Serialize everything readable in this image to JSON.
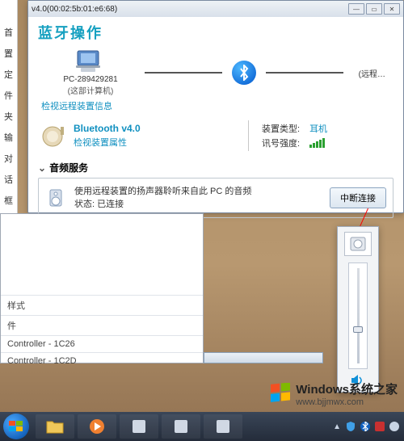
{
  "left_sidebar": {
    "items": [
      "首",
      "置",
      "定",
      "件夹",
      "输对话框"
    ]
  },
  "window": {
    "title": "v4.0(00:02:5b:01:e6:68)",
    "heading": "蓝牙操作",
    "pc": {
      "name": "PC-289429281",
      "sub": "(这部计算机)"
    },
    "remote": {
      "label": "(远程…"
    },
    "check_remote_info": "检视远程装置信息",
    "device": {
      "name": "Bluetooth v4.0",
      "check_props": "检视装置属性"
    },
    "type_label": "装置类型:",
    "type_value": "耳机",
    "signal_label": "讯号强度:",
    "audio_section": {
      "header": "音频服务",
      "line1": "使用远程装置的扬声器聆听来自此 PC 的音频",
      "line2_label": "状态:",
      "line2_value": "已连接",
      "disconnect": "中断连接"
    }
  },
  "lower_window": {
    "items": [
      "样式",
      "件"
    ],
    "controllers": [
      "Controller - 1C26",
      "Controller - 1C2D"
    ]
  },
  "watermark": {
    "brand": "Windows",
    "suffix": "系统之家",
    "url": "www.bjjmwx.com"
  }
}
